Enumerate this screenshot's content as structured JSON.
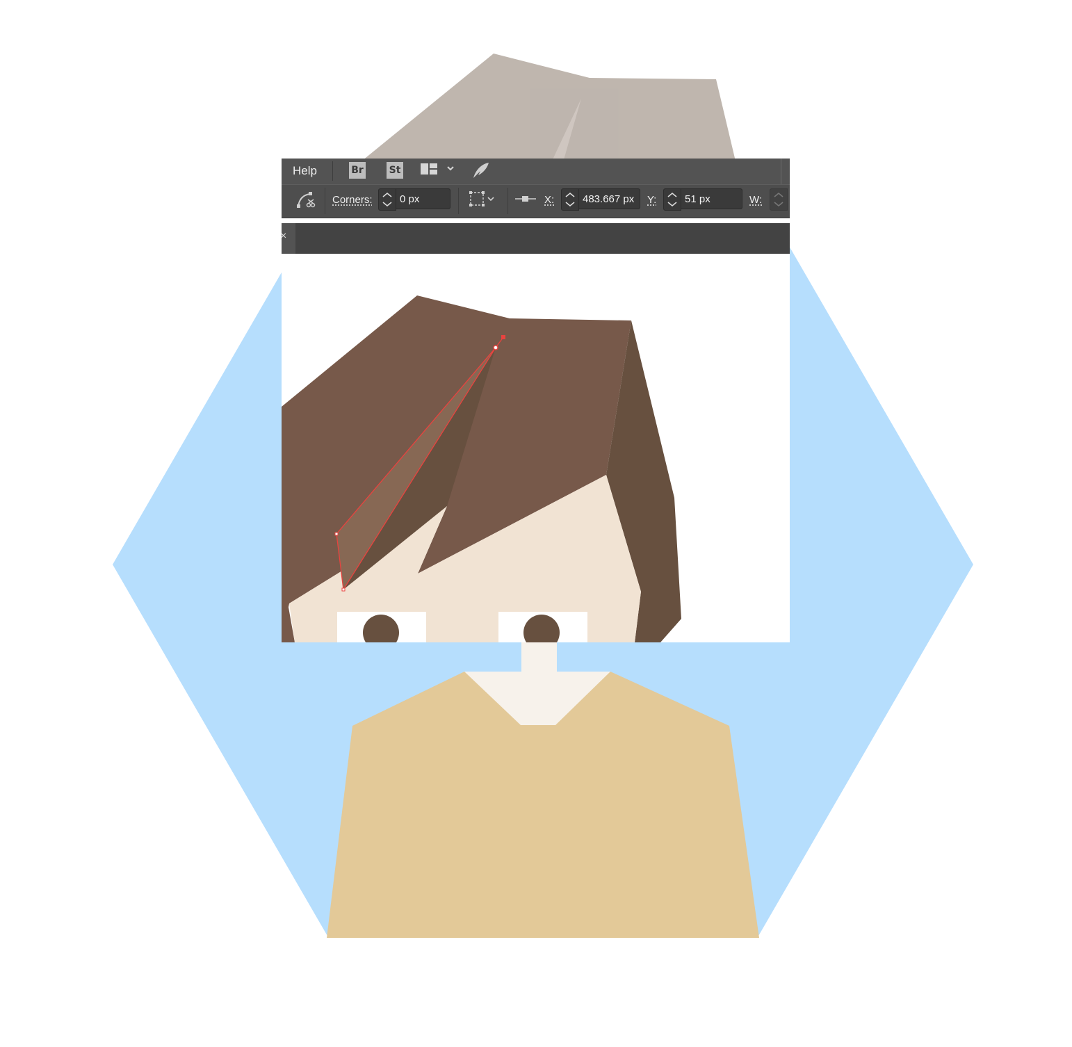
{
  "menu": {
    "help_label": "Help",
    "bridge_badge": "Br",
    "stock_badge": "St",
    "workspace_icon": "workspace-layout-icon",
    "feather_icon": "feather-rocket-icon"
  },
  "control_bar": {
    "corners_label": "Corners:",
    "corners_value": "0 px",
    "x_label": "X:",
    "x_value": "483.667 px",
    "y_label": "Y:",
    "y_value": "51 px",
    "w_label": "W:"
  },
  "document": {
    "close_glyph": "×"
  },
  "colors": {
    "hexagon": "#b6defd",
    "hair_dark": "#67503f",
    "hair": "#77594a",
    "hair_highlight": "#876854",
    "skin": "#f1e3d3",
    "shirt": "#e3c998",
    "collar": "#f7f2eb",
    "selection": "#e8433f",
    "ui_menu": "#535353",
    "ui_panel": "#4e4e4e"
  }
}
